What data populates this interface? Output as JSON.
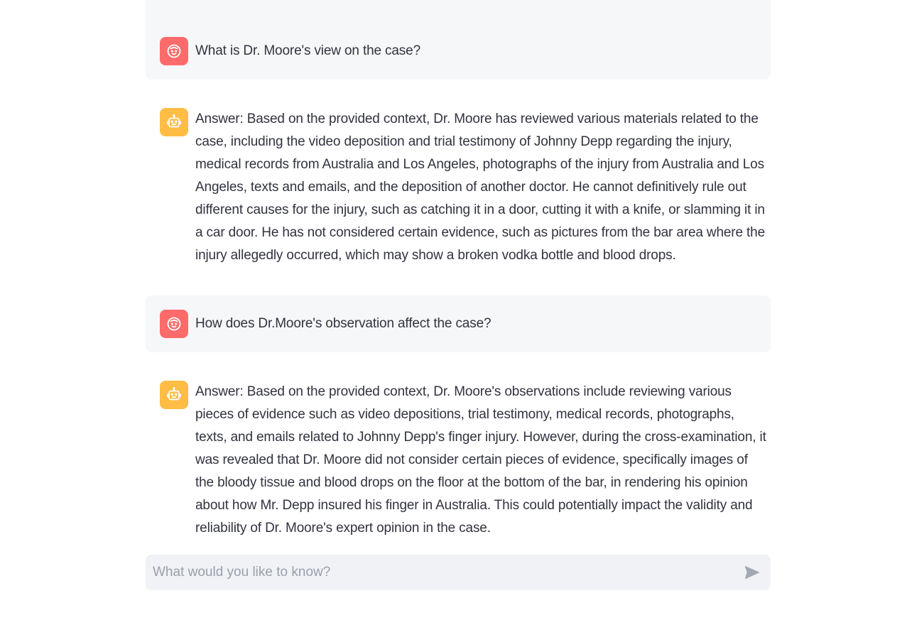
{
  "messages": [
    {
      "role": "user",
      "avatar_icon": "user-face-icon",
      "text": "What is Dr. Moore's view on the case?"
    },
    {
      "role": "assistant",
      "avatar_icon": "robot-icon",
      "text": "Answer: Based on the provided context, Dr. Moore has reviewed various materials related to the case, including the video deposition and trial testimony of Johnny Depp regarding the injury, medical records from Australia and Los Angeles, photographs of the injury from Australia and Los Angeles, texts and emails, and the deposition of another doctor. He cannot definitively rule out different causes for the injury, such as catching it in a door, cutting it with a knife, or slamming it in a car door. He has not considered certain evidence, such as pictures from the bar area where the injury allegedly occurred, which may show a broken vodka bottle and blood drops."
    },
    {
      "role": "user",
      "avatar_icon": "user-face-icon",
      "text": "How does Dr.Moore's observation affect the case?"
    },
    {
      "role": "assistant",
      "avatar_icon": "robot-icon",
      "text": "Answer: Based on the provided context, Dr. Moore's observations include reviewing various pieces of evidence such as video depositions, trial testimony, medical records, photographs, texts, and emails related to Johnny Depp's finger injury. However, during the cross-examination, it was revealed that Dr. Moore did not consider certain pieces of evidence, specifically images of the bloody tissue and blood drops on the floor at the bottom of the bar, in rendering his opinion about how Mr. Depp insured his finger in Australia. This could potentially impact the validity and reliability of Dr. Moore's expert opinion in the case."
    }
  ],
  "chat_input": {
    "placeholder": "What would you like to know?",
    "value": "",
    "send_icon": "send-icon"
  },
  "colors": {
    "user_avatar": "#ff6b6b",
    "assistant_avatar": "#ffbd45",
    "user_bubble": "#f6f7f9",
    "input_background": "#f0f2f6",
    "text": "#31333f",
    "placeholder": "#9aa0aa"
  }
}
